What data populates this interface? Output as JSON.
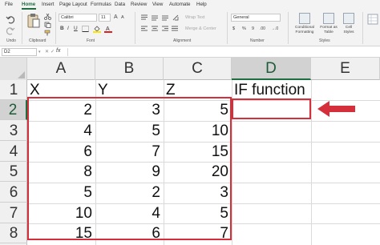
{
  "ribbon": {
    "tabs": [
      "File",
      "Home",
      "Insert",
      "Page Layout",
      "Formulas",
      "Data",
      "Review",
      "View",
      "Automate",
      "Help"
    ],
    "active_tab": "Home",
    "font_name": "Calibri",
    "font_size": "11",
    "font_buttons": [
      "B",
      "I",
      "U"
    ],
    "grow_font": "A",
    "shrink_font": "A",
    "wrap_text": "Wrap Text",
    "merge_center": "Merge & Center",
    "number_format": "General",
    "dollar_button": "$",
    "percent_button": "%",
    "comma_button": "9",
    "decrease_decimal": ".00",
    "increase_decimal": "→.0",
    "conditional_formatting": "Conditional\nFormatting",
    "format_as_table": "Format as\nTable",
    "cell_styles": "Cell\nStyles",
    "groups": [
      "Undo",
      "Clipboard",
      "Font",
      "Alignment",
      "Number",
      "Styles"
    ],
    "accent_color": "#1e6e42"
  },
  "formula_bar": {
    "name_box": "D2",
    "cancel": "✕",
    "enter": "✓",
    "fx": "fx",
    "formula": ""
  },
  "sheet": {
    "columns": [
      "A",
      "B",
      "C",
      "D",
      "E"
    ],
    "rows": [
      "1",
      "2",
      "3",
      "4",
      "5",
      "6",
      "7",
      "8"
    ],
    "selected_cell": "D2",
    "header": [
      "X",
      "Y",
      "Z",
      "IF function"
    ],
    "data": [
      [
        "2",
        "3",
        "5",
        ""
      ],
      [
        "4",
        "5",
        "10",
        ""
      ],
      [
        "6",
        "7",
        "15",
        ""
      ],
      [
        "8",
        "9",
        "20",
        ""
      ],
      [
        "5",
        "2",
        "3",
        ""
      ],
      [
        "10",
        "4",
        "5",
        ""
      ],
      [
        "15",
        "6",
        "7",
        ""
      ]
    ],
    "highlight_color": "#d62f3c"
  }
}
